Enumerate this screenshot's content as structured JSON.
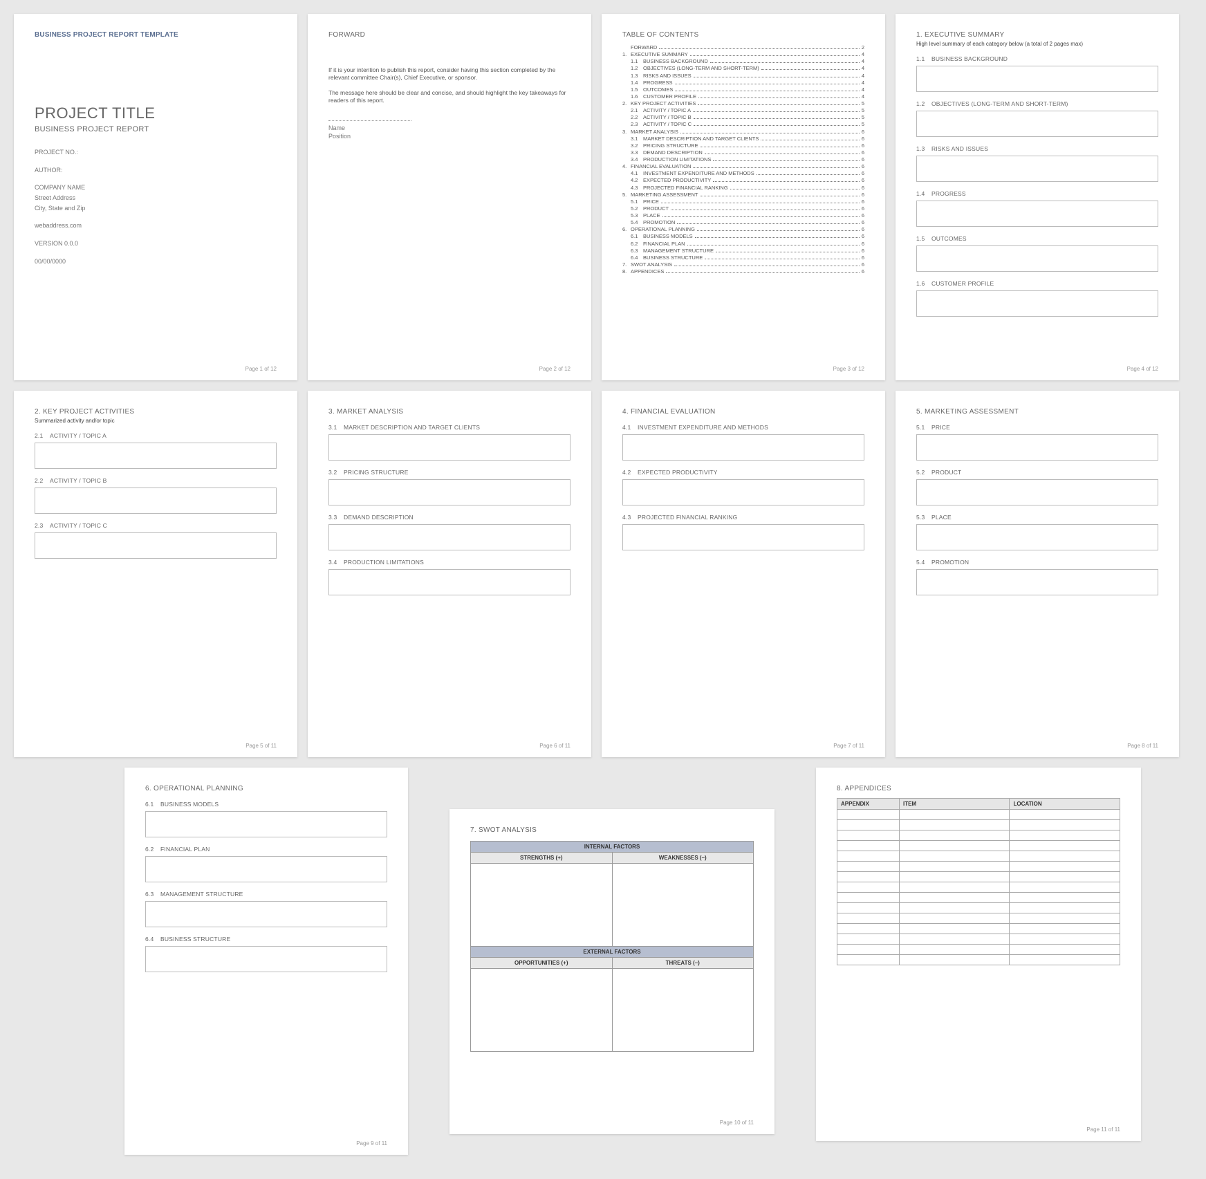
{
  "template_header": "BUSINESS PROJECT REPORT TEMPLATE",
  "page1": {
    "title": "PROJECT TITLE",
    "subtitle": "BUSINESS PROJECT REPORT",
    "project_no_label": "PROJECT NO.:",
    "author_label": "AUTHOR:",
    "company": "COMPANY NAME",
    "street": "Street Address",
    "city": "City, State and Zip",
    "web": "webaddress.com",
    "version": "VERSION 0.0.0",
    "date": "00/00/0000",
    "footer": "Page 1 of 12"
  },
  "page2": {
    "title": "FORWARD",
    "para1": "If it is your intention to publish this report, consider having this section completed by the relevant committee Chair(s), Chief Executive, or sponsor.",
    "para2": "The message here should be clear and concise, and should highlight the key takeaways for readers of this report.",
    "name_label": "Name",
    "position_label": "Position",
    "footer": "Page 2 of 12"
  },
  "page3": {
    "title": "TABLE OF CONTENTS",
    "entries": [
      {
        "lvl": 1,
        "num": "",
        "label": "FORWARD",
        "page": "2"
      },
      {
        "lvl": 1,
        "num": "1.",
        "label": "EXECUTIVE SUMMARY",
        "page": "4"
      },
      {
        "lvl": 2,
        "num": "1.1",
        "label": "BUSINESS BACKGROUND",
        "page": "4"
      },
      {
        "lvl": 2,
        "num": "1.2",
        "label": "OBJECTIVES (LONG-TERM AND SHORT-TERM)",
        "page": "4"
      },
      {
        "lvl": 2,
        "num": "1.3",
        "label": "RISKS AND ISSUES",
        "page": "4"
      },
      {
        "lvl": 2,
        "num": "1.4",
        "label": "PROGRESS",
        "page": "4"
      },
      {
        "lvl": 2,
        "num": "1.5",
        "label": "OUTCOMES",
        "page": "4"
      },
      {
        "lvl": 2,
        "num": "1.6",
        "label": "CUSTOMER PROFILE",
        "page": "4"
      },
      {
        "lvl": 1,
        "num": "2.",
        "label": "KEY PROJECT ACTIVITIES",
        "page": "5"
      },
      {
        "lvl": 2,
        "num": "2.1",
        "label": "ACTIVITY / TOPIC A",
        "page": "5"
      },
      {
        "lvl": 2,
        "num": "2.2",
        "label": "ACTIVITY / TOPIC B",
        "page": "5"
      },
      {
        "lvl": 2,
        "num": "2.3",
        "label": "ACTIVITY / TOPIC C",
        "page": "5"
      },
      {
        "lvl": 1,
        "num": "3.",
        "label": "MARKET ANALYSIS",
        "page": "6"
      },
      {
        "lvl": 2,
        "num": "3.1",
        "label": "MARKET DESCRIPTION AND TARGET CLIENTS",
        "page": "6"
      },
      {
        "lvl": 2,
        "num": "3.2",
        "label": "PRICING STRUCTURE",
        "page": "6"
      },
      {
        "lvl": 2,
        "num": "3.3",
        "label": "DEMAND DESCRIPTION",
        "page": "6"
      },
      {
        "lvl": 2,
        "num": "3.4",
        "label": "PRODUCTION LIMITATIONS",
        "page": "6"
      },
      {
        "lvl": 1,
        "num": "4.",
        "label": "FINANCIAL EVALUATION",
        "page": "6"
      },
      {
        "lvl": 2,
        "num": "4.1",
        "label": "INVESTMENT EXPENDITURE AND METHODS",
        "page": "6"
      },
      {
        "lvl": 2,
        "num": "4.2",
        "label": "EXPECTED PRODUCTIVITY",
        "page": "6"
      },
      {
        "lvl": 2,
        "num": "4.3",
        "label": "PROJECTED FINANCIAL RANKING",
        "page": "6"
      },
      {
        "lvl": 1,
        "num": "5.",
        "label": "MARKETING ASSESSMENT",
        "page": "6"
      },
      {
        "lvl": 2,
        "num": "5.1",
        "label": "PRICE",
        "page": "6"
      },
      {
        "lvl": 2,
        "num": "5.2",
        "label": "PRODUCT",
        "page": "6"
      },
      {
        "lvl": 2,
        "num": "5.3",
        "label": "PLACE",
        "page": "6"
      },
      {
        "lvl": 2,
        "num": "5.4",
        "label": "PROMOTION",
        "page": "6"
      },
      {
        "lvl": 1,
        "num": "6.",
        "label": "OPERATIONAL PLANNING",
        "page": "6"
      },
      {
        "lvl": 2,
        "num": "6.1",
        "label": "BUSINESS MODELS",
        "page": "6"
      },
      {
        "lvl": 2,
        "num": "6.2",
        "label": "FINANCIAL PLAN",
        "page": "6"
      },
      {
        "lvl": 2,
        "num": "6.3",
        "label": "MANAGEMENT STRUCTURE",
        "page": "6"
      },
      {
        "lvl": 2,
        "num": "6.4",
        "label": "BUSINESS STRUCTURE",
        "page": "6"
      },
      {
        "lvl": 1,
        "num": "7.",
        "label": "SWOT ANALYSIS",
        "page": "6"
      },
      {
        "lvl": 1,
        "num": "8.",
        "label": "APPENDICES",
        "page": "6"
      }
    ],
    "footer": "Page 3 of 12"
  },
  "page4": {
    "title": "1.  EXECUTIVE SUMMARY",
    "note": "High level summary of each category below (a total of 2 pages max)",
    "subs": [
      {
        "num": "1.1",
        "label": "BUSINESS BACKGROUND"
      },
      {
        "num": "1.2",
        "label": "OBJECTIVES (LONG-TERM AND SHORT-TERM)"
      },
      {
        "num": "1.3",
        "label": "RISKS AND ISSUES"
      },
      {
        "num": "1.4",
        "label": "PROGRESS"
      },
      {
        "num": "1.5",
        "label": "OUTCOMES"
      },
      {
        "num": "1.6",
        "label": "CUSTOMER PROFILE"
      }
    ],
    "footer": "Page 4 of 12"
  },
  "page5": {
    "title": "2.  KEY PROJECT ACTIVITIES",
    "note": "Summarized activity and/or topic",
    "subs": [
      {
        "num": "2.1",
        "label": "ACTIVITY / TOPIC A"
      },
      {
        "num": "2.2",
        "label": "ACTIVITY / TOPIC B"
      },
      {
        "num": "2.3",
        "label": "ACTIVITY / TOPIC C"
      }
    ],
    "footer": "Page 5 of 11"
  },
  "page6": {
    "title": "3.  MARKET ANALYSIS",
    "subs": [
      {
        "num": "3.1",
        "label": "MARKET DESCRIPTION AND TARGET CLIENTS"
      },
      {
        "num": "3.2",
        "label": "PRICING STRUCTURE"
      },
      {
        "num": "3.3",
        "label": "DEMAND DESCRIPTION"
      },
      {
        "num": "3.4",
        "label": "PRODUCTION LIMITATIONS"
      }
    ],
    "footer": "Page 6 of 11"
  },
  "page7": {
    "title": "4.  FINANCIAL EVALUATION",
    "subs": [
      {
        "num": "4.1",
        "label": "INVESTMENT EXPENDITURE AND METHODS"
      },
      {
        "num": "4.2",
        "label": "EXPECTED PRODUCTIVITY"
      },
      {
        "num": "4.3",
        "label": "PROJECTED FINANCIAL RANKING"
      }
    ],
    "footer": "Page 7 of 11"
  },
  "page8": {
    "title": "5.  MARKETING ASSESSMENT",
    "subs": [
      {
        "num": "5.1",
        "label": "PRICE"
      },
      {
        "num": "5.2",
        "label": "PRODUCT"
      },
      {
        "num": "5.3",
        "label": "PLACE"
      },
      {
        "num": "5.4",
        "label": "PROMOTION"
      }
    ],
    "footer": "Page 8 of 11"
  },
  "page9": {
    "title": "6.  OPERATIONAL PLANNING",
    "subs": [
      {
        "num": "6.1",
        "label": "BUSINESS MODELS"
      },
      {
        "num": "6.2",
        "label": "FINANCIAL PLAN"
      },
      {
        "num": "6.3",
        "label": "MANAGEMENT STRUCTURE"
      },
      {
        "num": "6.4",
        "label": "BUSINESS STRUCTURE"
      }
    ],
    "footer": "Page 9 of 11"
  },
  "page10": {
    "title": "7.  SWOT ANALYSIS",
    "internal": "INTERNAL FACTORS",
    "external": "EXTERNAL FACTORS",
    "strengths": "STRENGTHS (+)",
    "weaknesses": "WEAKNESSES (–)",
    "opportunities": "OPPORTUNITIES (+)",
    "threats": "THREATS (–)",
    "footer": "Page 10 of 11"
  },
  "page11": {
    "title": "8.  APPENDICES",
    "cols": [
      "APPENDIX",
      "ITEM",
      "LOCATION"
    ],
    "row_count": 15,
    "footer": "Page 11 of 11"
  }
}
